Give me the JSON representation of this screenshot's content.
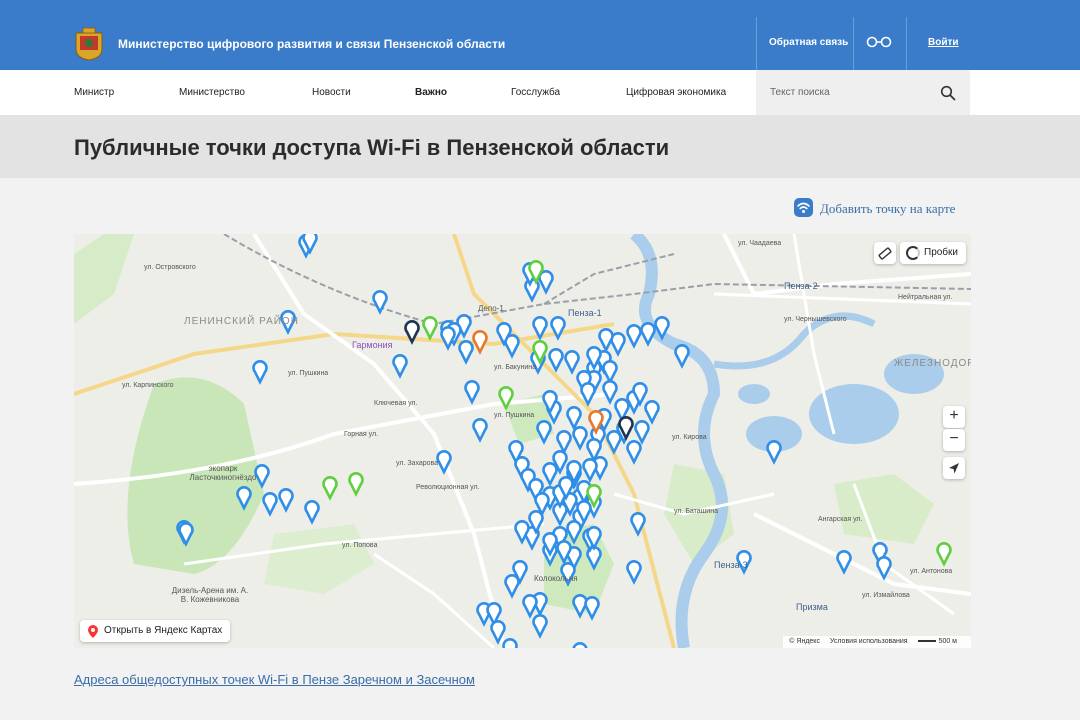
{
  "header": {
    "org_title": "Министерство цифрового развития и связи Пензенской области",
    "feedback": "Обратная связь",
    "login": "Войти",
    "icons": [
      "coat-of-arms-icon",
      "glasses-icon"
    ]
  },
  "nav": {
    "items": [
      {
        "label": "Министр"
      },
      {
        "label": "Министерство"
      },
      {
        "label": "Новости"
      },
      {
        "label": "Важно",
        "active": true
      },
      {
        "label": "Госслужба"
      },
      {
        "label": "Цифровая экономика"
      }
    ],
    "search_placeholder": "Текст поиска"
  },
  "page": {
    "title": "Публичные точки доступа Wi-Fi в Пензенской области",
    "add_point": "Добавить точку на карте",
    "addresses_link": "Адреса общедоступных точек Wi-Fi в Пензе Заречном и Засечном"
  },
  "map": {
    "traffic": "Пробки",
    "zoom_in": "+",
    "zoom_out": "−",
    "open_in_yandex": "Открыть в Яндекс Картах",
    "copyright": "© Яндекс",
    "terms": "Условия использования",
    "scale": "500 м",
    "districts": [
      "ЛЕНИНСКИЙ РАЙОН",
      "ЖЕЛЕЗНОДОРОЖНЫЙ"
    ],
    "stations": [
      "Пенза-1",
      "Пенза-2",
      "Пенза-3"
    ],
    "places": [
      "Гармония",
      "экопарк Ласточкиногнёздо",
      "Дизель-Арена им. А. В. Кожевникова",
      "Колокольня",
      "Призма",
      "Депо-1"
    ],
    "streets": [
      "ул. Чаадаева",
      "ул. Островского",
      "ул. Карпинского",
      "ул. Пушкина",
      "Ключевая ул.",
      "Горная ул.",
      "ул. Захарова",
      "Революционная ул.",
      "ул. Попова",
      "ул. Бакунина",
      "ул. Пушкина",
      "ул. Кирова",
      "ул. Антонова",
      "ул. Измайлова",
      "Ангарская ул.",
      "ул. Баташина",
      "Нейтральная ул.",
      "ул. Чернышевского"
    ],
    "colors": {
      "pin_blue": "#2f8ee8",
      "pin_green": "#5fcf3e",
      "pin_orange": "#e8782a",
      "pin_dark": "#1f3550",
      "river": "#a9cdea",
      "park": "#c8e6b8"
    },
    "markers": {
      "blue": 118,
      "green": 8,
      "orange": 2,
      "dark": 2
    }
  }
}
